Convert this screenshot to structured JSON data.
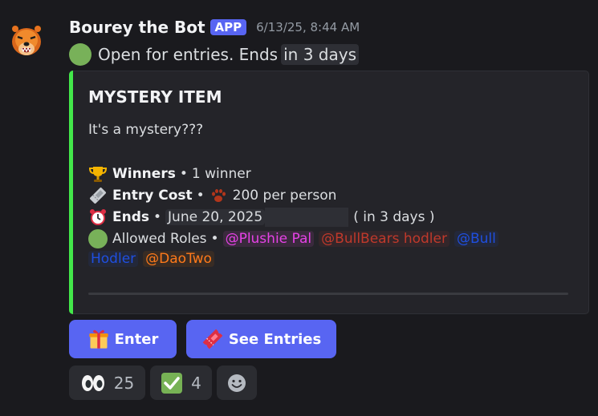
{
  "message": {
    "author": "Bourey the Bot",
    "badge": "APP",
    "timestamp": "6/13/25, 8:44 AM",
    "status_text": "Open for entries. Ends",
    "status_time": "in 3 days"
  },
  "embed": {
    "title": "MYSTERY ITEM",
    "description": "It's a mystery???",
    "winners_label": "Winners",
    "winners_value": "1 winner",
    "entry_cost_label": "Entry Cost",
    "entry_cost_value": "200 per person",
    "ends_label": "Ends",
    "ends_date": "June 20, 2025",
    "ends_relative": "( in 3 days )",
    "roles_label": "Allowed Roles",
    "roles": [
      "@Plushie Pal",
      "@BullBears hodler",
      "@Bull",
      "Hodler",
      "@DaoTwo"
    ],
    "bullet": "•",
    "accent_color": "#43e84a"
  },
  "buttons": {
    "enter_label": "Enter",
    "see_entries_label": "See Entries"
  },
  "reactions": [
    {
      "emoji": "eyes-icon",
      "count": "25"
    },
    {
      "emoji": "check-mark-icon",
      "count": "4"
    },
    {
      "emoji": "add-reaction-icon",
      "count": ""
    }
  ],
  "colors": {
    "background": "#1a1a1e",
    "blurple": "#5865f2",
    "green": "#78b159"
  }
}
